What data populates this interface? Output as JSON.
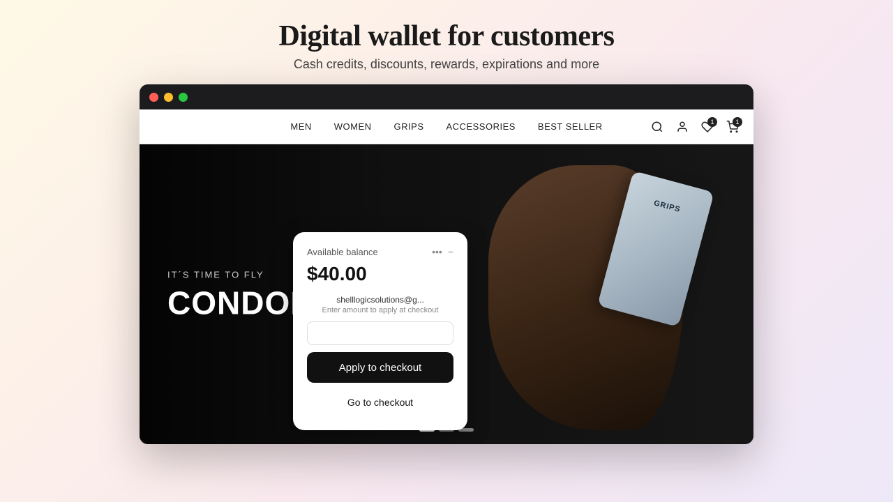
{
  "page": {
    "title": "Digital wallet for customers",
    "subtitle": "Cash credits, discounts, rewards, expirations and more"
  },
  "browser": {
    "traffic_lights": [
      "red",
      "yellow",
      "green"
    ]
  },
  "nav": {
    "links": [
      "MEN",
      "WOMEN",
      "GRIPS",
      "ACCESSORIES",
      "BEST SELLER"
    ],
    "icons": {
      "search": "🔍",
      "user": "👤",
      "wishlist": "♡",
      "cart": "🛒",
      "wishlist_count": "1",
      "cart_count": "1"
    }
  },
  "hero": {
    "eyebrow": "IT´S TIME TO FLY",
    "headline": "CONDOR GRIPS",
    "product_label": "GRIPS"
  },
  "carousel": {
    "dots": [
      true,
      false,
      false
    ]
  },
  "wallet": {
    "label": "Available balance",
    "balance": "$40.00",
    "email": "shelllogicsolutions@g...",
    "hint": "Enter amount to apply at checkout",
    "input_placeholder": "",
    "apply_btn": "Apply to checkout",
    "checkout_btn": "Go to checkout",
    "more_icon": "•••",
    "close_icon": "−"
  }
}
